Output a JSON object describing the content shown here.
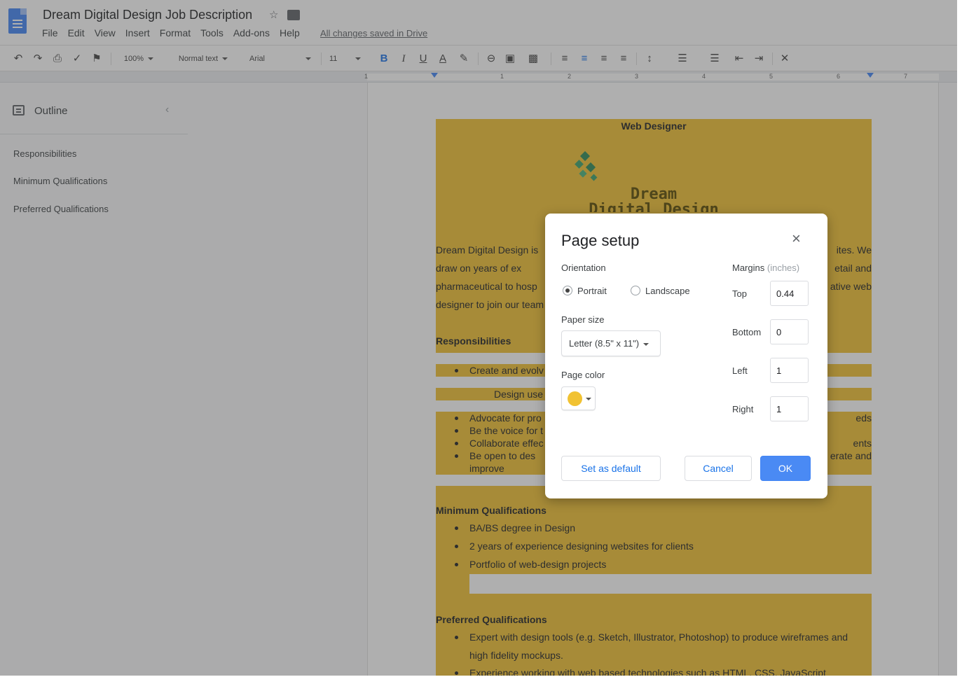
{
  "document": {
    "title": "Dream Digital Design Job Description",
    "save_status": "All changes saved in Drive"
  },
  "menu": [
    "File",
    "Edit",
    "View",
    "Insert",
    "Format",
    "Tools",
    "Add-ons",
    "Help"
  ],
  "toolbar": {
    "zoom": "100%",
    "style": "Normal text",
    "font": "Arial",
    "font_size": "11",
    "bold_label": "B",
    "italic_label": "I",
    "underline_label": "U",
    "text_color_label": "A"
  },
  "ruler": {
    "numbers": [
      "1",
      "1",
      "2",
      "3",
      "4",
      "5",
      "6",
      "7"
    ]
  },
  "outline": {
    "title": "Outline",
    "items": [
      "Responsibilities",
      "Minimum Qualifications",
      "Preferred Qualifications"
    ]
  },
  "page": {
    "page_color": "#f1c232",
    "heading": "Web Designer",
    "logo_line1": "Dream",
    "logo_line2": "Digital Design",
    "intro_left": [
      "Dream Digital Design is",
      "draw on years of ex",
      "pharmaceutical to hosp",
      "designer to join our team"
    ],
    "intro_right": [
      "ites. We",
      "etail and",
      "ative web"
    ],
    "responsibilities_heading": "Responsibilities",
    "resp_bullet_1": "Create and evolv",
    "resp_sub": "Design use",
    "resp_bullets_left": [
      "Advocate for pro",
      "Be the voice for t",
      "Collaborate effec",
      "Be open to des"
    ],
    "resp_improve": "improve",
    "resp_right": [
      "eds",
      "ents",
      "erate and"
    ],
    "minimum_heading": "Minimum Qualifications",
    "minimum_items": [
      "BA/BS degree in Design",
      "2 years of experience designing websites for clients",
      "Portfolio of web-design projects"
    ],
    "preferred_heading": "Preferred Qualifications",
    "preferred_item_1a": "Expert with design tools (e.g. Sketch, Illustrator, Photoshop) to produce wireframes and",
    "preferred_item_1b": "high fidelity mockups.",
    "preferred_item_2": "Experience working with web based technologies such as HTML, CSS, JavaScript"
  },
  "dialog": {
    "title": "Page setup",
    "orientation_label": "Orientation",
    "orientation_options": [
      "Portrait",
      "Landscape"
    ],
    "orientation_selected": "Portrait",
    "paper_size_label": "Paper size",
    "paper_size_value": "Letter (8.5\" x 11\")",
    "page_color_label": "Page color",
    "page_color_value": "#f1c232",
    "margins_label": "Margins",
    "margins_unit": "(inches)",
    "margins": {
      "top": {
        "label": "Top",
        "value": "0.44"
      },
      "bottom": {
        "label": "Bottom",
        "value": "0"
      },
      "left": {
        "label": "Left",
        "value": "1"
      },
      "right": {
        "label": "Right",
        "value": "1"
      }
    },
    "buttons": {
      "set_default": "Set as default",
      "cancel": "Cancel",
      "ok": "OK"
    }
  }
}
